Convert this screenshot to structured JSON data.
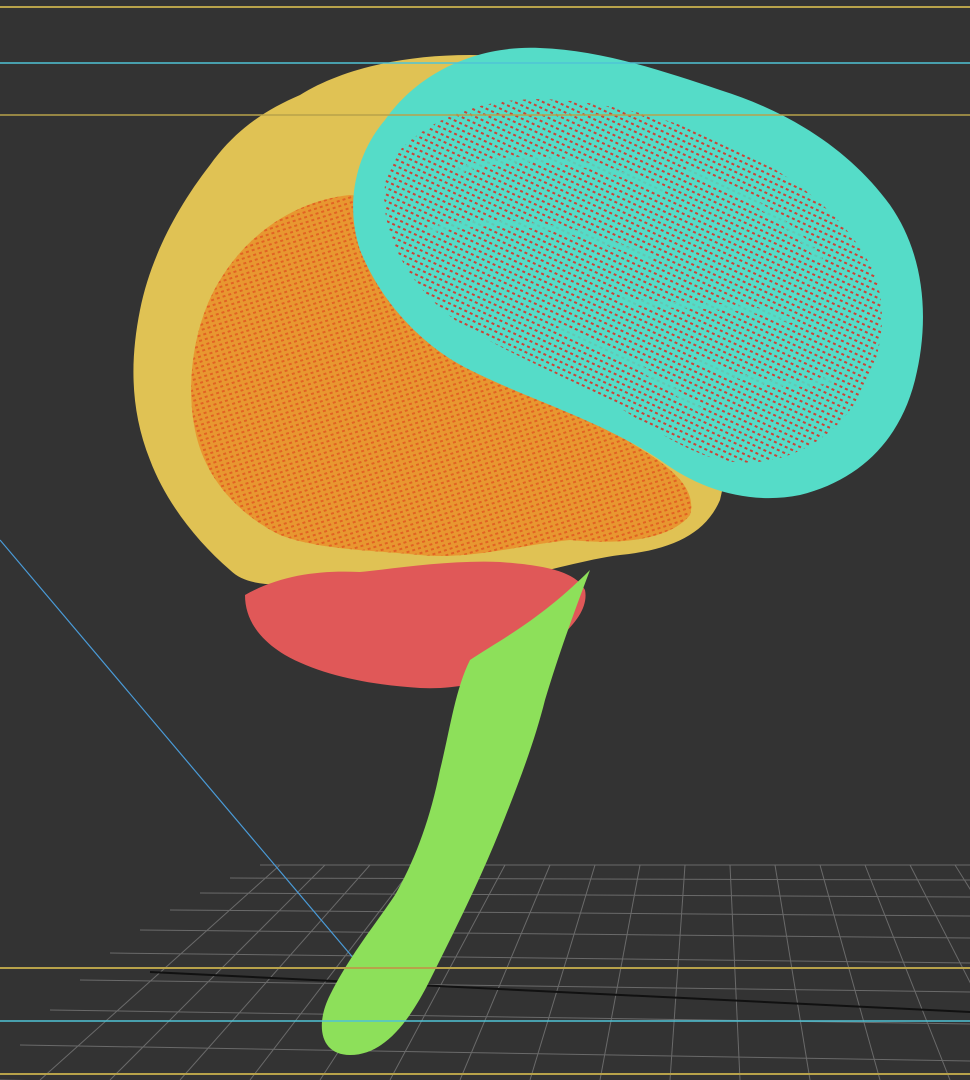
{
  "viewport": {
    "background": "#333333"
  },
  "guides": {
    "frame_color": "#b8a24a",
    "cyan_color": "#4fc3d6",
    "axis_color": "#4a9bd8",
    "grid_color": "#6a6a6a"
  },
  "model": {
    "regions": [
      {
        "name": "cerebral-outer-layer",
        "color": "#e0c254"
      },
      {
        "name": "temporal-lobe",
        "color": "#e9922c"
      },
      {
        "name": "frontal-parietal-cortex",
        "color": "#55dcc8"
      },
      {
        "name": "cortex-inner-points",
        "color": "#d84638"
      },
      {
        "name": "cerebellum",
        "color": "#e05858"
      },
      {
        "name": "brain-stem",
        "color": "#8de05a"
      }
    ]
  }
}
